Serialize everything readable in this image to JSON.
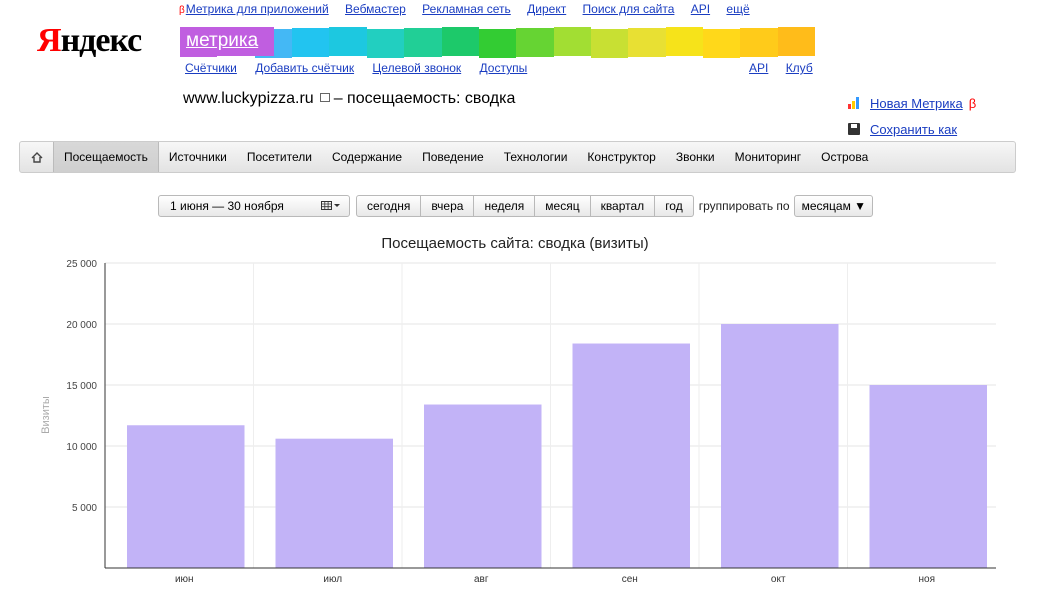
{
  "logo": {
    "first": "Я",
    "rest": "ндекс"
  },
  "services": {
    "beta_mark": "β",
    "items": [
      "Метрика для приложений",
      "Вебмастер",
      "Рекламная сеть",
      "Директ",
      "Поиск для сайта",
      "API",
      "ещё"
    ]
  },
  "product_title": "метрика",
  "rainbow_colors": [
    "#c05ee0",
    "#5aa0f0",
    "#44b8f5",
    "#22c4f0",
    "#1dc8e0",
    "#22cfc0",
    "#21cf96",
    "#1dc96a",
    "#33cc33",
    "#66d433",
    "#a2de33",
    "#c8e033",
    "#e8e033",
    "#f6e31a",
    "#ffd81a",
    "#ffcb1a",
    "#ffbc1a"
  ],
  "subnav": {
    "left": [
      "Счётчики",
      "Добавить счётчик",
      "Целевой звонок",
      "Доступы"
    ],
    "right": [
      "API",
      "Клуб"
    ]
  },
  "site": {
    "domain": "www.luckypizza.ru",
    "suffix": "– посещаемость: сводка"
  },
  "right_links": {
    "new_metrika": "Новая Метрика",
    "beta": "β",
    "save_as": "Сохранить как"
  },
  "tabs": [
    "Посещаемость",
    "Источники",
    "Посетители",
    "Содержание",
    "Поведение",
    "Технологии",
    "Конструктор",
    "Звонки",
    "Мониторинг",
    "Острова"
  ],
  "active_tab": 0,
  "filters": {
    "date_range": "1 июня — 30 ноября",
    "periods": [
      "сегодня",
      "вчера",
      "неделя",
      "месяц",
      "квартал",
      "год"
    ],
    "group_label": "группировать по",
    "group_value": "месяцам ▼"
  },
  "colors": {
    "bar": "#c2b3f7",
    "accent": "#1a3dc1"
  },
  "chart_data": {
    "type": "bar",
    "title": "Посещаемость сайта: сводка (визиты)",
    "ylabel": "Визиты",
    "categories": [
      "июн",
      "июл",
      "авг",
      "сен",
      "окт",
      "ноя"
    ],
    "values": [
      11700,
      10600,
      13400,
      18400,
      20000,
      15000
    ],
    "ylim": [
      0,
      25000
    ],
    "yticks": [
      5000,
      10000,
      15000,
      20000,
      25000
    ],
    "ytick_labels": [
      "5 000",
      "10 000",
      "15 000",
      "20 000",
      "25 000"
    ],
    "grid": true,
    "legend": "none"
  }
}
